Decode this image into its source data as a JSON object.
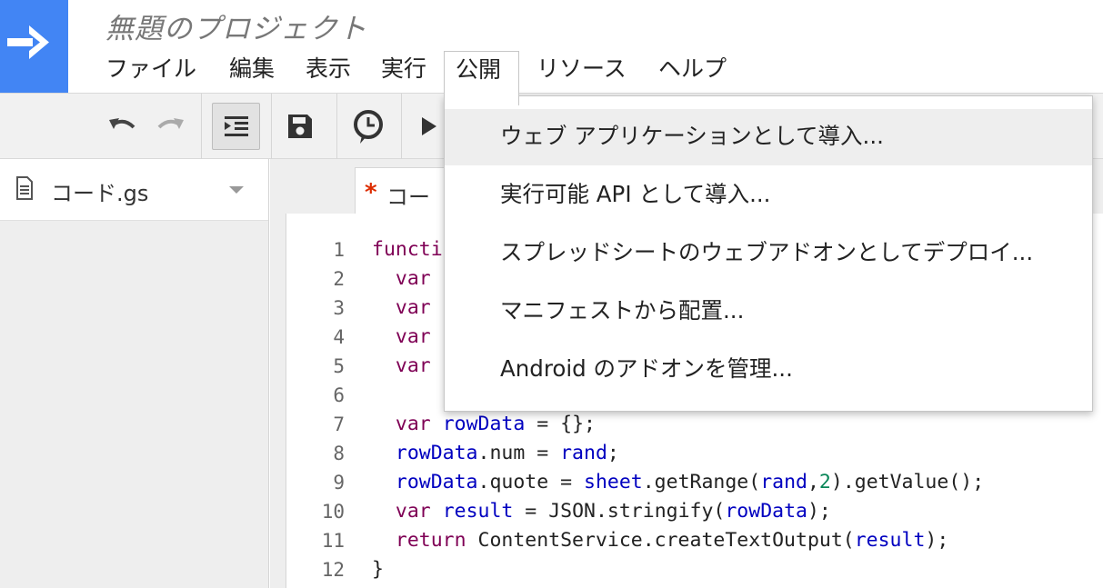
{
  "app": {
    "title": "無題のプロジェクト",
    "logo_icon": "arrow-right-icon",
    "accent_color": "#4285f4"
  },
  "menu": {
    "items": [
      {
        "label": "ファイル"
      },
      {
        "label": "編集"
      },
      {
        "label": "表示"
      },
      {
        "label": "実行"
      },
      {
        "label": "公開",
        "active": true
      },
      {
        "label": "リソース"
      },
      {
        "label": "ヘルプ"
      }
    ]
  },
  "toolbar": {
    "buttons": [
      "undo-icon",
      "redo-icon",
      "indent-icon",
      "save-icon",
      "clock-icon",
      "run-icon"
    ]
  },
  "files": {
    "current": "コード.gs",
    "icon": "document-icon"
  },
  "tab": {
    "modified_marker": "*",
    "label": "コー"
  },
  "dropdown": {
    "items": [
      {
        "label": "ウェブ アプリケーションとして導入...",
        "highlighted": true
      },
      {
        "label": "実行可能 API として導入..."
      },
      {
        "label": "スプレッドシートのウェブアドオンとしてデプロイ..."
      },
      {
        "label": "マニフェストから配置..."
      },
      {
        "label": "Android のアドオンを管理..."
      }
    ]
  },
  "editor": {
    "line_numbers": [
      "1",
      "2",
      "3",
      "4",
      "5",
      "6",
      "7",
      "8",
      "9",
      "10",
      "11",
      "12"
    ],
    "lines": [
      [
        {
          "t": "functi",
          "c": "keyword"
        }
      ],
      [
        {
          "t": "  "
        },
        {
          "t": "var",
          "c": "keyword"
        }
      ],
      [
        {
          "t": "  "
        },
        {
          "t": "var",
          "c": "keyword"
        }
      ],
      [
        {
          "t": "  "
        },
        {
          "t": "var",
          "c": "keyword"
        }
      ],
      [
        {
          "t": "  "
        },
        {
          "t": "var",
          "c": "keyword"
        }
      ],
      [],
      [
        {
          "t": "  "
        },
        {
          "t": "var",
          "c": "keyword"
        },
        {
          "t": " "
        },
        {
          "t": "rowData",
          "c": "variable"
        },
        {
          "t": " = {};"
        }
      ],
      [
        {
          "t": "  "
        },
        {
          "t": "rowData",
          "c": "variable"
        },
        {
          "t": ".num = "
        },
        {
          "t": "rand",
          "c": "variable"
        },
        {
          "t": ";"
        }
      ],
      [
        {
          "t": "  "
        },
        {
          "t": "rowData",
          "c": "variable"
        },
        {
          "t": ".quote = "
        },
        {
          "t": "sheet",
          "c": "variable"
        },
        {
          "t": ".getRange("
        },
        {
          "t": "rand",
          "c": "variable"
        },
        {
          "t": ","
        },
        {
          "t": "2",
          "c": "number"
        },
        {
          "t": ").getValue();"
        }
      ],
      [
        {
          "t": "  "
        },
        {
          "t": "var",
          "c": "keyword"
        },
        {
          "t": " "
        },
        {
          "t": "result",
          "c": "variable"
        },
        {
          "t": " = JSON.stringify("
        },
        {
          "t": "rowData",
          "c": "variable"
        },
        {
          "t": ");"
        }
      ],
      [
        {
          "t": "  "
        },
        {
          "t": "return",
          "c": "keyword"
        },
        {
          "t": " ContentService.createTextOutput("
        },
        {
          "t": "result",
          "c": "variable"
        },
        {
          "t": ");"
        }
      ],
      [
        {
          "t": "}"
        }
      ]
    ]
  }
}
